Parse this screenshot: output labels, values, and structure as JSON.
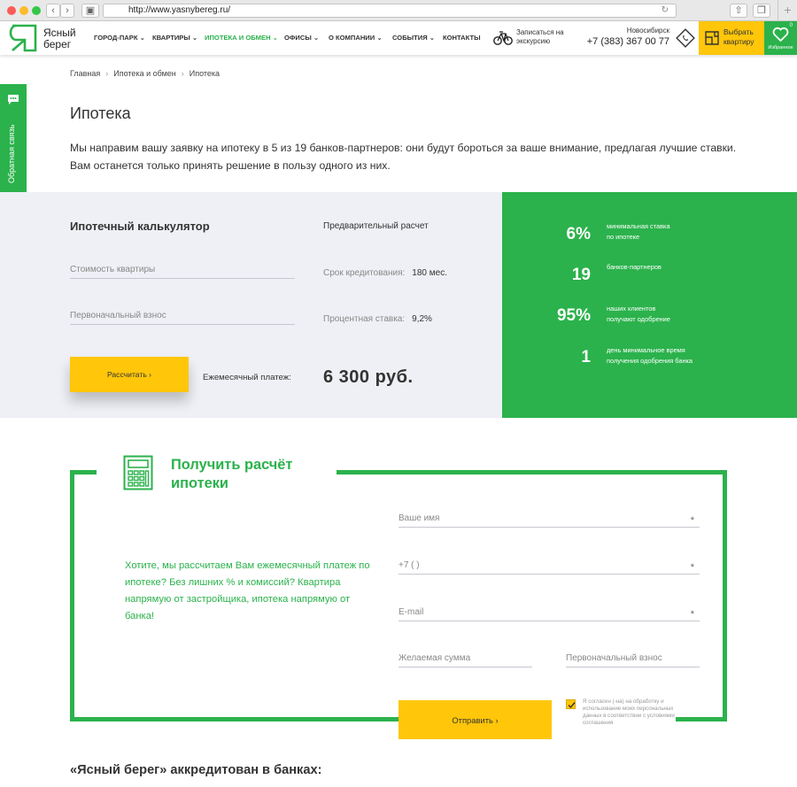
{
  "browser": {
    "url": "http://www.yasnybereg.ru/"
  },
  "header": {
    "logo_line1": "Ясный",
    "logo_line2": "берег",
    "nav": [
      {
        "label": "ГОРОД-ПАРК ⌄"
      },
      {
        "label": "КВАРТИРЫ ⌄"
      },
      {
        "label": "ИПОТЕКА И ОБМЕН ⌄"
      },
      {
        "label": "ОФИСЫ ⌄"
      },
      {
        "label": "О КОМПАНИИ ⌄"
      },
      {
        "label": "СОБЫТИЯ ⌄"
      },
      {
        "label": "КОНТАКТЫ"
      }
    ],
    "excursion_line1": "Записаться на",
    "excursion_line2": "экскурсию",
    "city": "Новосибирск",
    "phone": "+7 (383) 367 00 77",
    "choose_line1": "Выбрать",
    "choose_line2": "квартиру",
    "favorites_label": "Избранное",
    "favorites_count": "0",
    "accent": "#2bb24c",
    "yellow": "#ffc60a"
  },
  "feedback_label": "Обратная связь",
  "breadcrumbs": [
    "Главная",
    "Ипотека и обмен",
    "Ипотека"
  ],
  "page_title": "Ипотека",
  "intro": "Мы направим вашу заявку на ипотеку в 5 из 19 банков-партнеров: они будут бороться за ваше внимание, предлагая лучшие ставки. Вам останется только принять решение в пользу одного из них.",
  "calculator": {
    "title": "Ипотечный калькулятор",
    "price_placeholder": "Стоимость квартиры",
    "down_payment_placeholder": "Первоначальный взнос",
    "calc_button": "Рассчитать  ›",
    "pre_title": "Предварительный расчет",
    "term_label": "Срок кредитования:",
    "term_value": "180 мес.",
    "rate_label": "Процентная ставка:",
    "rate_value": "9,2%",
    "payment_label": "Ежемесячный платеж:",
    "payment_value": "6 300 руб."
  },
  "stats": [
    {
      "num": "6%",
      "line1": "минимальная ставка",
      "line2": "по ипотеке"
    },
    {
      "num": "19",
      "line1": "банков-партнеров",
      "line2": ""
    },
    {
      "num": "95%",
      "line1": "наших клиентов",
      "line2": "получают одобрение"
    },
    {
      "num": "1",
      "line1": "день минимальное время",
      "line2": "получения одобрения банка"
    }
  ],
  "form": {
    "title": "Получить расчёт ипотеки",
    "text": "Хотите, мы рассчитаем Вам ежемесячный платеж по ипотеке? Без лишних % и комиссий? Квартира напрямую от застройщика, ипотека напрямую от банка!",
    "name_placeholder": "Ваше имя",
    "phone_placeholder": "+7 (   )",
    "email_placeholder": "E-mail",
    "sum_placeholder": "Желаемая сумма",
    "down_placeholder": "Первоначальный взнос",
    "required_mark": "*",
    "send_button": "Отправить  ›",
    "agree_text": "Я согласен (-на) на обработку и использование моих персональных данных в соответствии с условиями соглашения"
  },
  "accredited_title": "«Ясный берег» аккредитован в банках:"
}
